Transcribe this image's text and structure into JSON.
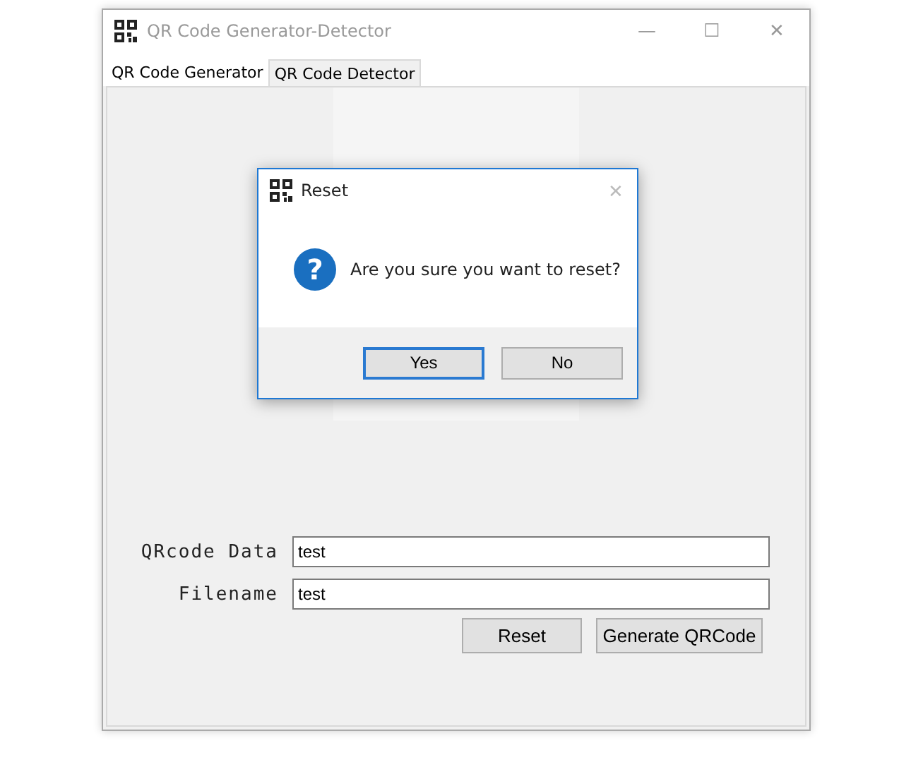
{
  "window": {
    "title": "QR Code Generator-Detector",
    "controls": [
      "—",
      "☐",
      "✕"
    ]
  },
  "tabs": [
    {
      "label": "QR Code Generator",
      "selected": true
    },
    {
      "label": "QR Code Detector",
      "selected": false
    }
  ],
  "form": {
    "fields": [
      {
        "label": "QRcode Data",
        "value": "test"
      },
      {
        "label": "Filename",
        "value": "test"
      }
    ],
    "buttons": [
      "Reset",
      "Generate QRCode"
    ]
  },
  "dialog": {
    "title": "Reset",
    "close": "✕",
    "message": "Are you sure you want to reset?",
    "icon": "?",
    "buttons": [
      {
        "label": "Yes",
        "focused": true
      },
      {
        "label": "No",
        "focused": false
      }
    ]
  }
}
